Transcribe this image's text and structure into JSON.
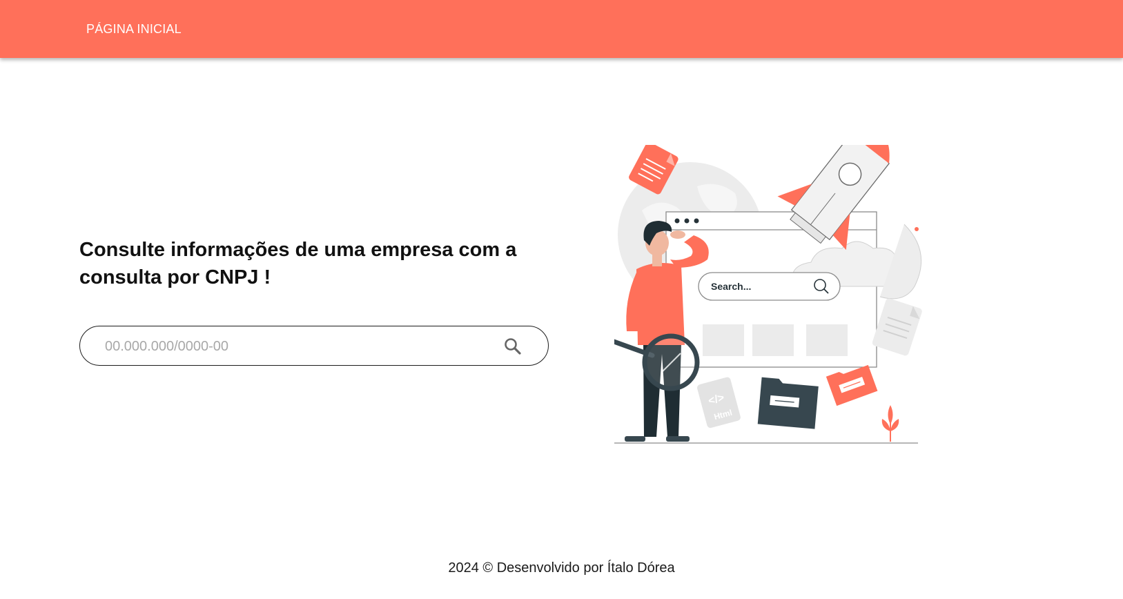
{
  "header": {
    "nav_home_label": "PÁGINA INICIAL",
    "background_color": "#ff705a"
  },
  "main": {
    "headline_line1": "Consulte informações de uma empresa com a",
    "headline_line2": "consulta por CNPJ !",
    "search": {
      "value": "",
      "placeholder": "00.000.000/0000-00",
      "button_icon": "search-icon"
    },
    "illustration": {
      "search_bar_text": "Search...",
      "file_label": "Html",
      "accent_color": "#ff705a",
      "dark_color": "#37474f"
    }
  },
  "footer": {
    "text": "2024 © Desenvolvido por Ítalo Dórea"
  }
}
